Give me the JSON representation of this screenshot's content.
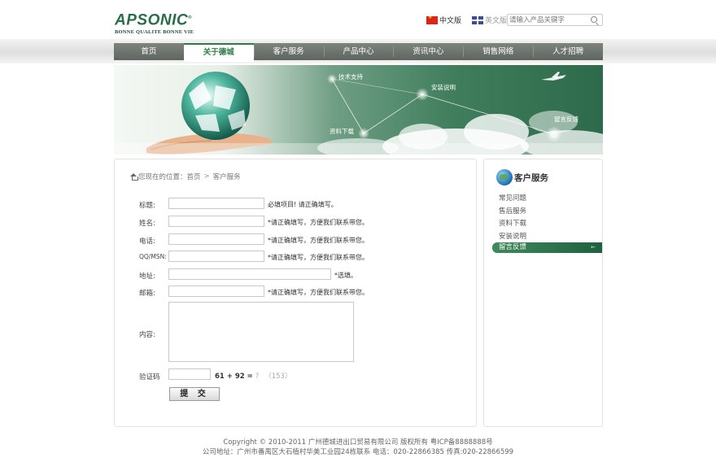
{
  "brand": {
    "name": "APSONIC",
    "mark": "®",
    "tagline": "BONNE QUALITE BONNE VIE"
  },
  "header": {
    "lang_cn": "中文版",
    "lang_en": "英文版",
    "search_placeholder": "请输入产品关键字"
  },
  "nav": {
    "items": [
      "首页",
      "关于德城",
      "客户服务",
      "产品中心",
      "资讯中心",
      "销售网络",
      "人才招聘"
    ],
    "active_index": 1
  },
  "banner": {
    "labels": [
      "技术支持",
      "安装说明",
      "资料下载",
      "留言反馈"
    ]
  },
  "breadcrumb": {
    "prefix": "您现在的位置：",
    "home": "首页",
    "separator": ">",
    "current": "客户服务"
  },
  "form": {
    "fields": [
      {
        "label": "标题:",
        "hint": "必填项目! 请正确填写。"
      },
      {
        "label": "姓名:",
        "hint": "*请正确填写，方便我们联系带您。"
      },
      {
        "label": "电话:",
        "hint": "*请正确填写，方便我们联系带您。"
      },
      {
        "label": "QQ/MSN:",
        "hint": "*请正确填写，方便我们联系带您。"
      },
      {
        "label": "地址:",
        "hint": "*选填。"
      },
      {
        "label": "邮箱:",
        "hint": "*请正确填写，方便我们联系带您。"
      },
      {
        "label": "内容:"
      }
    ],
    "captcha": {
      "label": "验证码",
      "expression": "61 + 92 =",
      "question_mark": "?",
      "answer": "（153）"
    },
    "submit_label": "提 交"
  },
  "sidebar": {
    "title": "客户服务",
    "items": [
      "常见问题",
      "售后服务",
      "资料下载",
      "安装说明",
      "留言反馈"
    ],
    "active_index": 4
  },
  "footer": {
    "copyright": "Copyright © 2010-2011 广州德城进出口贸易有限公司 版权所有 粤ICP备8888888号",
    "address": "公司地址：广州市番禺区大石植村华美工业园24栋联系 电话：020-22866385 传真:020-22866599"
  },
  "colors": {
    "brand_green": "#2a6e48",
    "nav_gray": "#6a706a",
    "active_green": "#2e7a47"
  }
}
